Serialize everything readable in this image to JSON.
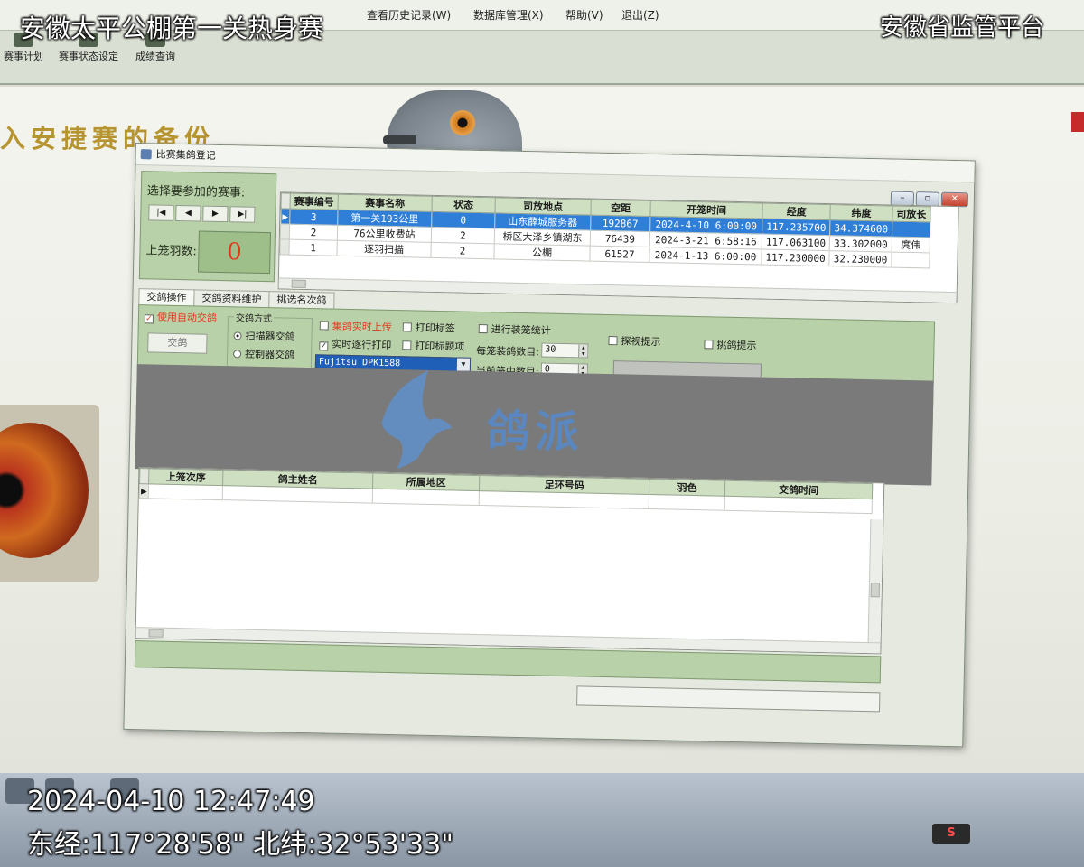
{
  "overlay": {
    "top_left": "安徽太平公棚第一关热身赛",
    "top_right": "安徽省监管平台",
    "timestamp": "2024-04-10 12:47:49",
    "coords": "东经:117°28'58\" 北纬:32°53'33\""
  },
  "menu": [
    {
      "label": "查看历史记录(W)"
    },
    {
      "label": "数据库管理(X)"
    },
    {
      "label": "帮助(V)"
    },
    {
      "label": "退出(Z)"
    }
  ],
  "toolbar": [
    {
      "label": "赛事计划"
    },
    {
      "label": "赛事状态设定"
    },
    {
      "label": "成绩查询"
    }
  ],
  "banner": "入安捷赛的备份",
  "taskbar_badge": "S",
  "dialog": {
    "title": "比赛集鸽登记",
    "select_race_label": "选择要参加的赛事:",
    "nav": [
      "|◀",
      "◀",
      "▶",
      "▶|"
    ],
    "cage_count_label": "上笼羽数:",
    "cage_count": "0",
    "race_table": {
      "columns": [
        "赛事编号",
        "赛事名称",
        "状态",
        "司放地点",
        "空距",
        "开笼时间",
        "经度",
        "纬度",
        "司放长"
      ],
      "rows": [
        {
          "id": "3",
          "name": "第一关193公里",
          "status": "0",
          "place": "山东薛城服务器",
          "distance": "192867",
          "open_time": "2024-4-10 6:00:00",
          "lng": "117.235700",
          "lat": "34.374600",
          "official": ""
        },
        {
          "id": "2",
          "name": "76公里收费站",
          "status": "2",
          "place": "桥区大泽乡镇湖东",
          "distance": "76439",
          "open_time": "2024-3-21 6:58:16",
          "lng": "117.063100",
          "lat": "33.302000",
          "official": "庹伟"
        },
        {
          "id": "1",
          "name": "逐羽扫描",
          "status": "2",
          "place": "公棚",
          "distance": "61527",
          "open_time": "2024-1-13 6:00:00",
          "lng": "117.230000",
          "lat": "32.230000",
          "official": ""
        }
      ]
    },
    "tabs": [
      "交鸽操作",
      "交鸽资料维护",
      "挑选名次鸽"
    ],
    "auto_checkbox": "使用自动交鸽",
    "submit_button": "交鸽",
    "method_group": {
      "title": "交鸽方式",
      "options": [
        "扫描器交鸽",
        "控制器交鸽"
      ]
    },
    "upload_checkbox": "集鸽实时上传",
    "realtime_print": "实时逐行打印",
    "print_label": "打印标签",
    "print_title": "打印标题项",
    "cage_stats": "进行装笼统计",
    "per_cage_label": "每笼装鸽数目:",
    "per_cage_value": "30",
    "current_cage_label": "当前笼中数目:",
    "current_cage_value": "0",
    "scanner": "Fujitsu DPK1588",
    "visit_tip": "探视提示",
    "pick_tip": "挑鸽提示",
    "logo_text": "鸽派",
    "entry_table": {
      "columns": [
        "上笼次序",
        "鸽主姓名",
        "所属地区",
        "足环号码",
        "羽色",
        "交鸽时间"
      ]
    }
  },
  "colors": {
    "panel_green": "#b9d1a8",
    "selection_blue": "#2f7fd8",
    "count_red": "#e0391c"
  }
}
